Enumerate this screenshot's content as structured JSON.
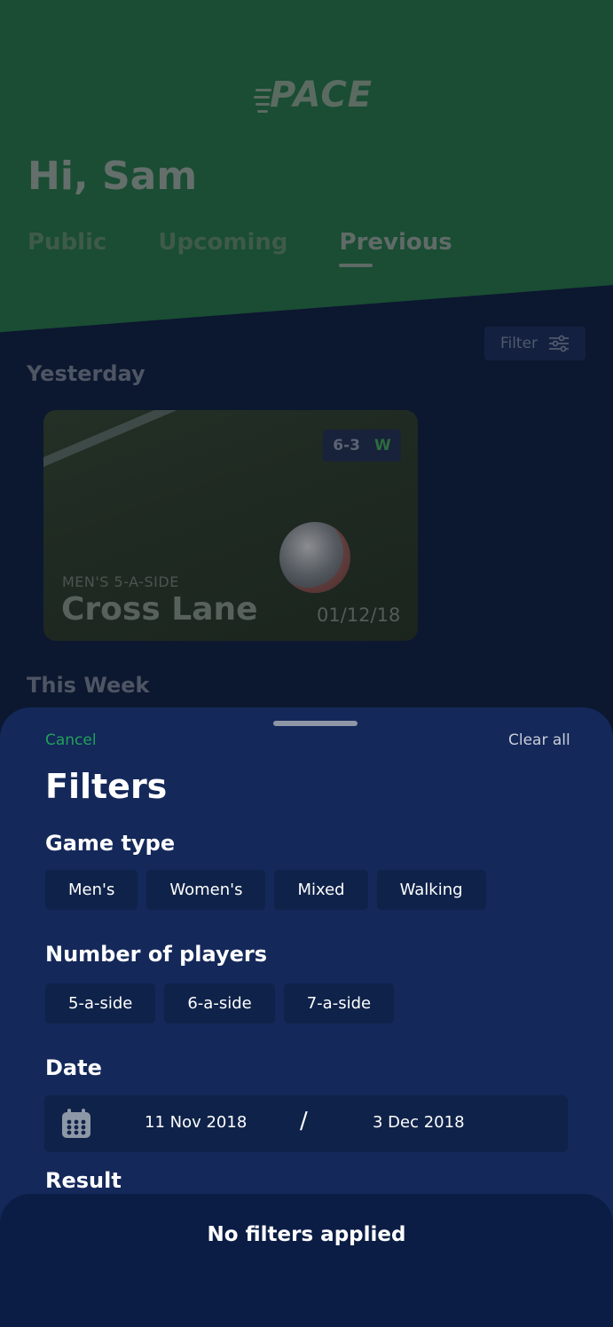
{
  "background": {
    "logo": "PACE",
    "greeting": "Hi, Sam",
    "tabs": [
      {
        "label": "Public"
      },
      {
        "label": "Upcoming"
      },
      {
        "label": "Previous"
      }
    ],
    "filter_button": "Filter",
    "section_yesterday": "Yesterday",
    "section_this_week": "This Week",
    "card": {
      "type": "MEN'S 5-A-SIDE",
      "venue": "Cross Lane",
      "date": "01/12/18",
      "score": "6-3",
      "result": "W"
    }
  },
  "sheet": {
    "cancel": "Cancel",
    "clear_all": "Clear all",
    "title": "Filters",
    "game_type": {
      "label": "Game type",
      "options": [
        "Men's",
        "Women's",
        "Mixed",
        "Walking"
      ]
    },
    "players": {
      "label": "Number of players",
      "options": [
        "5-a-side",
        "6-a-side",
        "7-a-side"
      ]
    },
    "date": {
      "label": "Date",
      "from": "11 Nov 2018",
      "separator": "/",
      "to": "3 Dec 2018"
    },
    "result_label": "Result"
  },
  "footer": {
    "status": "No filters applied"
  },
  "colors": {
    "accent_green": "#22a05a",
    "sheet_bg": "#14285a",
    "chip_bg": "#0f2249"
  }
}
